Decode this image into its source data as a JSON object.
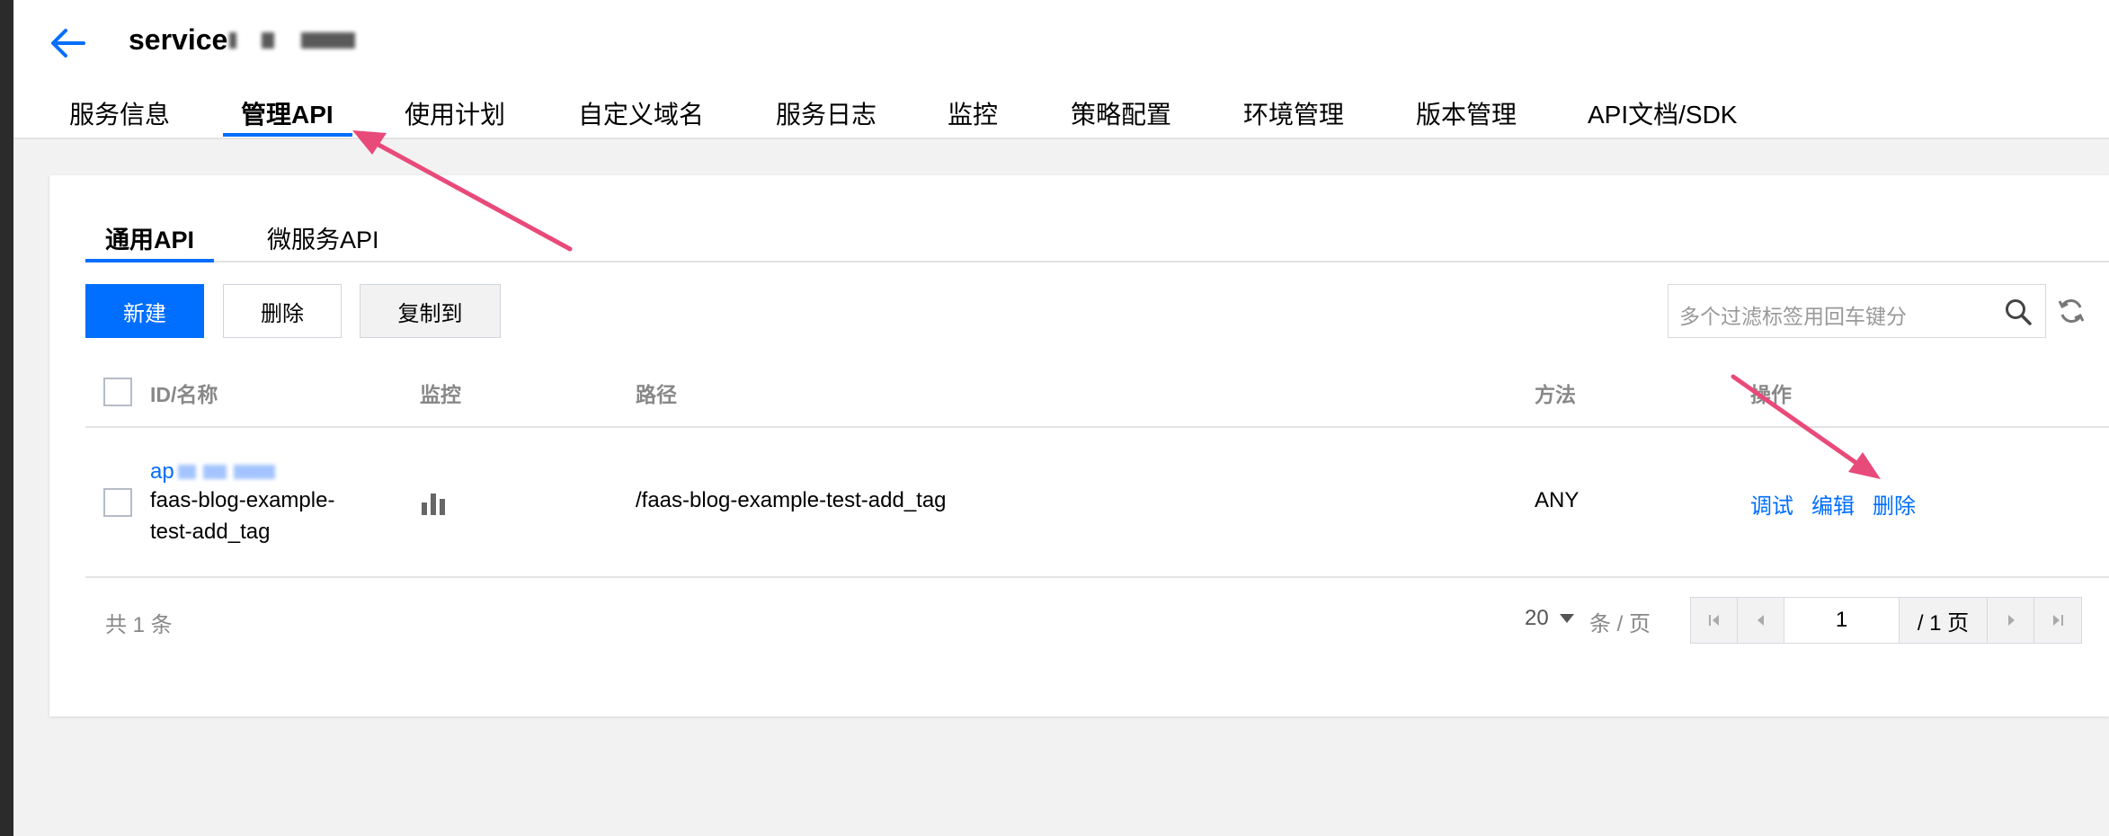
{
  "header": {
    "service_name": "service"
  },
  "nav": {
    "tabs": [
      {
        "label": "服务信息"
      },
      {
        "label": "管理API"
      },
      {
        "label": "使用计划"
      },
      {
        "label": "自定义域名"
      },
      {
        "label": "服务日志"
      },
      {
        "label": "监控"
      },
      {
        "label": "策略配置"
      },
      {
        "label": "环境管理"
      },
      {
        "label": "版本管理"
      },
      {
        "label": "API文档/SDK"
      }
    ],
    "active": "管理API"
  },
  "subtabs": [
    {
      "label": "通用API"
    },
    {
      "label": "微服务API"
    }
  ],
  "toolbar": {
    "new_label": "新建",
    "delete_label": "删除",
    "copy_label": "复制到",
    "search_placeholder": "多个过滤标签用回车键分"
  },
  "table": {
    "columns": {
      "id_name": "ID/名称",
      "monitor": "监控",
      "path": "路径",
      "method": "方法",
      "actions": "操作"
    },
    "rows": [
      {
        "id": "ap",
        "name_line1": "faas-blog-example-",
        "name_line2": "test-add_tag",
        "path": "/faas-blog-example-test-add_tag",
        "method": "ANY",
        "actions": {
          "debug": "调试",
          "edit": "编辑",
          "delete": "删除"
        }
      }
    ]
  },
  "pagination": {
    "total_text": "共 1 条",
    "page_size": "20",
    "per_page_text": "条 / 页",
    "current_page": "1",
    "total_pages_text": "/ 1 页"
  },
  "colors": {
    "accent": "#006eff",
    "annotation_arrow": "#e84a7a"
  }
}
